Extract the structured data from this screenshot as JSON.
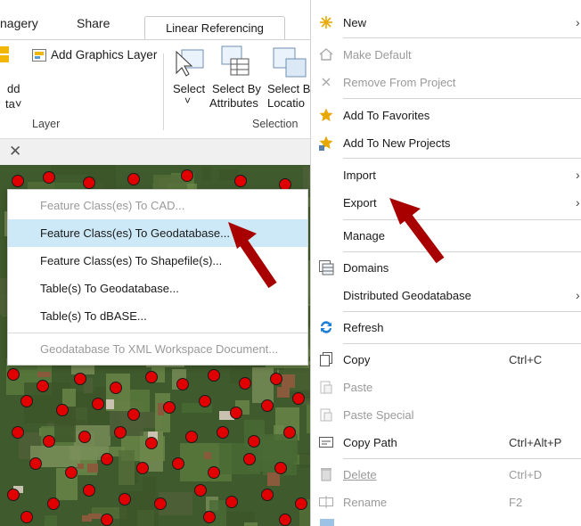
{
  "ribbon": {
    "tabs": [
      "nagery",
      "Share",
      "Linear Referencing"
    ],
    "add_graphics_layer": "Add Graphics Layer",
    "add_partial_1": "dd",
    "add_partial_2": "ta˅",
    "select": "Select",
    "select_by_attributes_1": "Select By",
    "select_by_attributes_2": "Attributes",
    "select_by_location_1": "Select B",
    "select_by_location_2": "Locatio",
    "select_dropdown": "˅",
    "group_layer": "Layer",
    "group_selection": "Selection"
  },
  "submenu": {
    "items": [
      {
        "label": "Feature Class(es) To CAD...",
        "disabled": true
      },
      {
        "label": "Feature Class(es) To Geodatabase...",
        "highlighted": true
      },
      {
        "label": "Feature Class(es) To Shapefile(s)..."
      },
      {
        "label": "Table(s) To Geodatabase..."
      },
      {
        "label": "Table(s) To dBASE..."
      },
      {
        "label": "Geodatabase To XML Workspace Document...",
        "disabled": true
      }
    ]
  },
  "context_menu": {
    "items": [
      {
        "label": "New",
        "submenu": true,
        "icon": "new-icon"
      },
      {
        "label": "Make Default",
        "disabled": true,
        "icon": "home-icon"
      },
      {
        "label": "Remove From Project",
        "disabled": true,
        "icon": "remove-icon"
      },
      {
        "label": "Add To Favorites",
        "icon": "star-icon"
      },
      {
        "label": "Add To New Projects",
        "icon": "star-plus-icon"
      },
      {
        "label": "Import",
        "submenu": true
      },
      {
        "label": "Export",
        "submenu": true
      },
      {
        "label": "Manage"
      },
      {
        "label": "Domains",
        "icon": "domains-icon"
      },
      {
        "label": "Distributed Geodatabase",
        "submenu": true
      },
      {
        "label": "Refresh",
        "icon": "refresh-icon"
      },
      {
        "label": "Copy",
        "shortcut": "Ctrl+C",
        "icon": "copy-icon"
      },
      {
        "label": "Paste",
        "disabled": true,
        "icon": "paste-icon"
      },
      {
        "label": "Paste Special",
        "disabled": true,
        "icon": "paste-special-icon"
      },
      {
        "label": "Copy Path",
        "shortcut": "Ctrl+Alt+P",
        "icon": "copy-path-icon"
      },
      {
        "label": "Delete",
        "shortcut": "Ctrl+D",
        "disabled": true,
        "icon": "delete-icon"
      },
      {
        "label": "Rename",
        "shortcut": "F2",
        "disabled": true,
        "icon": "rename-icon"
      }
    ]
  },
  "colors": {
    "highlight": "#cde8f6",
    "arrow": "#a80000",
    "points": "#e00000",
    "star": "#e8a800",
    "refresh": "#1e7fd8"
  }
}
